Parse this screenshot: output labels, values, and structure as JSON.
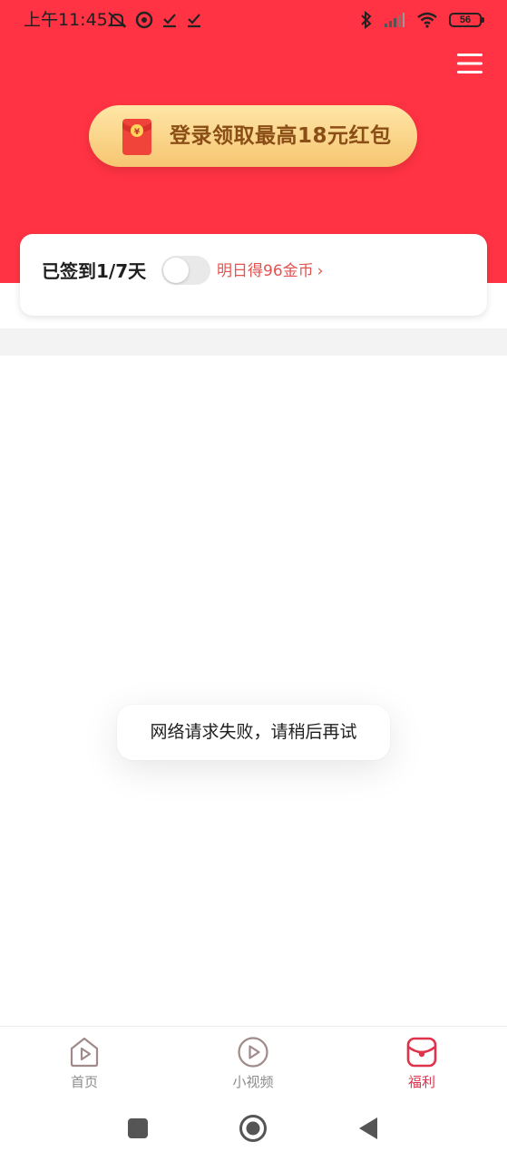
{
  "status_bar": {
    "time": "上午11:45",
    "left_icons": [
      "silent-icon",
      "location-icon",
      "download-check-icon",
      "download-check-icon"
    ],
    "right_icons": [
      "bluetooth-icon",
      "signal-icon",
      "wifi-icon"
    ],
    "battery_level": "56"
  },
  "header": {
    "background_color": "#ff3343",
    "menu_icon": "hamburger-menu-icon",
    "login_button_label": "登录领取最高18元红包"
  },
  "checkin": {
    "title": "已签到1/7天",
    "toggle_on": false,
    "reward_link": "明日得96金币",
    "reward_chevron": "›"
  },
  "toast": {
    "message": "网络请求失败，请稍后再试"
  },
  "tabbar": {
    "tabs": [
      {
        "label": "首页",
        "icon": "home-play-icon",
        "active": false
      },
      {
        "label": "小视频",
        "icon": "video-play-icon",
        "active": false
      },
      {
        "label": "福利",
        "icon": "gift-bag-icon",
        "active": true
      }
    ],
    "active_color": "#e0334a",
    "inactive_color": "#8c8c8c"
  },
  "system_nav": {
    "buttons": [
      "recents-square-icon",
      "home-circle-icon",
      "back-triangle-icon"
    ]
  }
}
